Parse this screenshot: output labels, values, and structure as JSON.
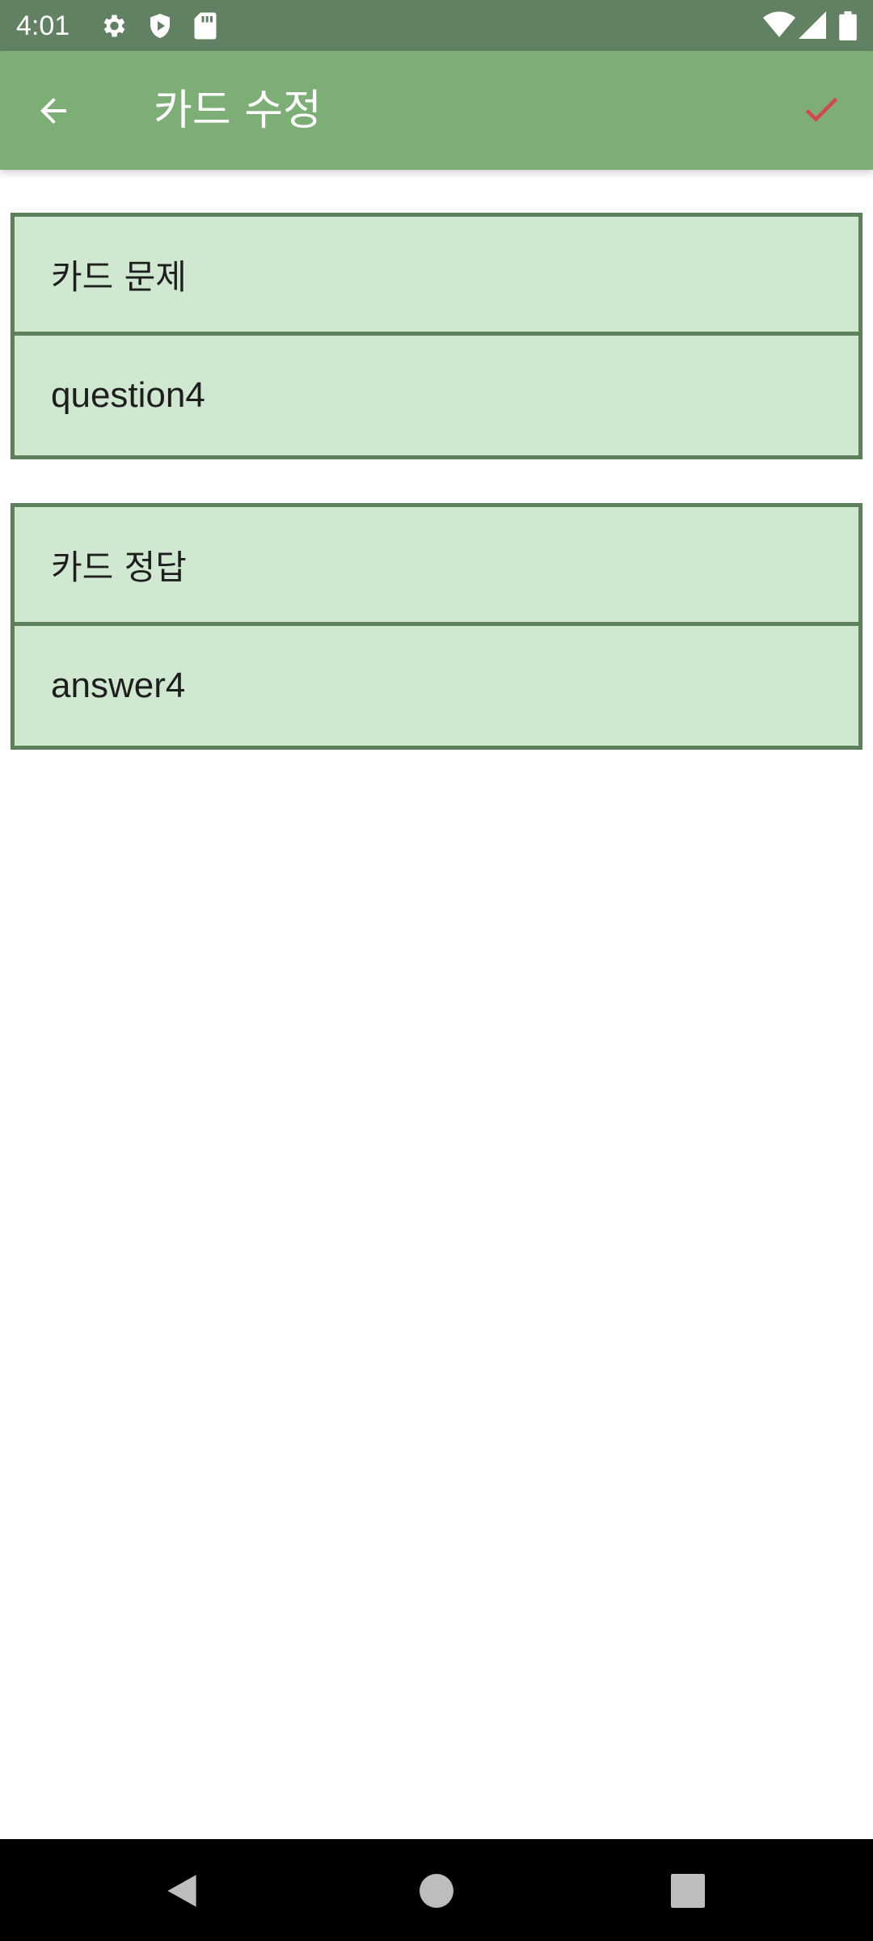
{
  "status_bar": {
    "time": "4:01",
    "icons_left": [
      "settings-icon",
      "shield-play-icon",
      "sd-card-icon"
    ],
    "icons_right": [
      "wifi-icon",
      "signal-icon",
      "battery-icon"
    ]
  },
  "app_bar": {
    "title": "카드 수정",
    "back_icon": "arrow-back-icon",
    "save_icon": "check-icon",
    "background": "#7dae76",
    "status_background": "#628062",
    "check_color": "#d9434f"
  },
  "question_group": {
    "label": "카드 문제",
    "value": "question4"
  },
  "answer_group": {
    "label": "카드 정답",
    "value": "answer4"
  },
  "colors": {
    "field_background": "#d0e7d0",
    "field_border": "#5c7f5c"
  },
  "nav_bar": {
    "buttons": [
      "back-triangle-icon",
      "home-circle-icon",
      "recents-square-icon"
    ]
  }
}
